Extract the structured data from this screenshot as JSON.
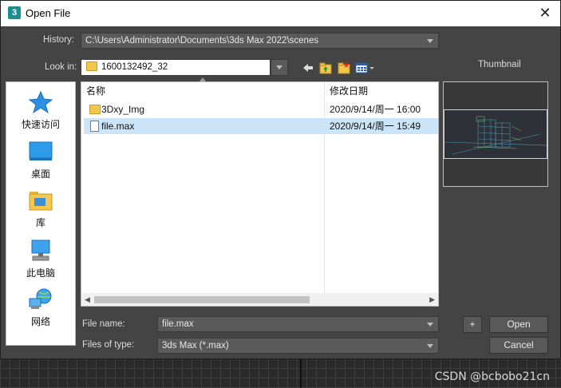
{
  "window": {
    "title": "Open File",
    "app_icon": "3",
    "close_glyph": "✕"
  },
  "history": {
    "label": "History:",
    "value": "C:\\Users\\Administrator\\Documents\\3ds Max 2022\\scenes"
  },
  "look_in": {
    "label": "Look in:",
    "value": "1600132492_32"
  },
  "thumbnail": {
    "label": "Thumbnail"
  },
  "places": [
    {
      "label": "快速访问",
      "icon": "star-icon"
    },
    {
      "label": "桌面",
      "icon": "desktop-icon"
    },
    {
      "label": "库",
      "icon": "library-icon"
    },
    {
      "label": "此电脑",
      "icon": "computer-icon"
    },
    {
      "label": "网络",
      "icon": "network-icon"
    }
  ],
  "file_list": {
    "columns": [
      "名称",
      "修改日期"
    ],
    "rows": [
      {
        "name": "3Dxy_Img",
        "date": "2020/9/14/周一 16:00",
        "type": "folder",
        "selected": false
      },
      {
        "name": "file.max",
        "date": "2020/9/14/周一 15:49",
        "type": "file",
        "selected": true
      }
    ]
  },
  "file_name": {
    "label": "File name:",
    "value": "file.max"
  },
  "file_type": {
    "label": "Files of type:",
    "value": "3ds Max (*.max)"
  },
  "buttons": {
    "plus": "+",
    "open": "Open",
    "cancel": "Cancel"
  },
  "watermark": "CSDN @bcbobo21cn",
  "colors": {
    "selection": "#cce4f7",
    "dialog_bg": "#444444",
    "folder": "#f3c64d"
  }
}
